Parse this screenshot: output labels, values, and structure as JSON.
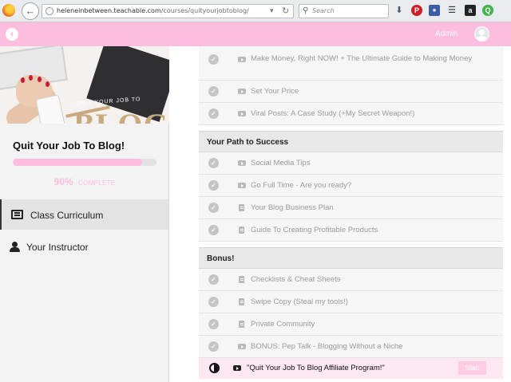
{
  "browser": {
    "url_host": "heleneinbetween.teachable.com",
    "url_path": "/courses/quityourjobtoblog/",
    "search_placeholder": "Search",
    "toolbar_icons": [
      "download-icon",
      "pinterest-icon",
      "extension-icon",
      "layers-icon",
      "amazon-icon",
      "green-extension-icon"
    ]
  },
  "header": {
    "back_icon": "chevron-left-icon",
    "user_name": "Admin",
    "accent_color": "#fcbdde"
  },
  "sidebar": {
    "cover": {
      "small_text": "QUIT YOUR JOB TO",
      "big_text": "BLOG"
    },
    "course_title": "Quit Your Job To Blog!",
    "progress": {
      "percent": 90,
      "percent_label": "90%",
      "complete_label": "COMPLETE"
    },
    "nav": [
      {
        "label": "Class Curriculum",
        "icon": "list-icon",
        "active": true
      },
      {
        "label": "Your Instructor",
        "icon": "user-icon",
        "active": false
      }
    ]
  },
  "curriculum": {
    "sections": [
      {
        "title": "",
        "lectures": [
          {
            "title": "Make Money, Right NOW! + The Ultimate Guide to Making Money",
            "type": "video",
            "completed": true
          },
          {
            "title": "Set Your Price",
            "type": "video",
            "completed": true
          },
          {
            "title": "Viral Posts: A Case Study (+My Secret Weapon!)",
            "type": "video",
            "completed": true
          }
        ]
      },
      {
        "title": "Your Path to Success",
        "lectures": [
          {
            "title": "Social Media Tips",
            "type": "video",
            "completed": true
          },
          {
            "title": "Go Full Time - Are you ready?",
            "type": "video",
            "completed": true
          },
          {
            "title": "Your Blog Business Plan",
            "type": "document",
            "completed": true
          },
          {
            "title": "Guide To Creating Profitable Products",
            "type": "document",
            "completed": true
          }
        ]
      },
      {
        "title": "Bonus!",
        "lectures": [
          {
            "title": "Checklists & Cheat Sheets",
            "type": "document",
            "completed": true
          },
          {
            "title": "Swipe Copy (Steal my tools!)",
            "type": "document",
            "completed": true
          },
          {
            "title": "Private Community",
            "type": "document",
            "completed": true
          },
          {
            "title": "BONUS: Pep Talk - Blogging Without a Niche",
            "type": "video",
            "completed": true
          }
        ]
      }
    ],
    "current_lecture": {
      "title": "\"Quit Your Job To Blog Affiliate Program!\"",
      "type": "video",
      "status_icon": "half-circle-icon",
      "button_label": "Start"
    }
  }
}
